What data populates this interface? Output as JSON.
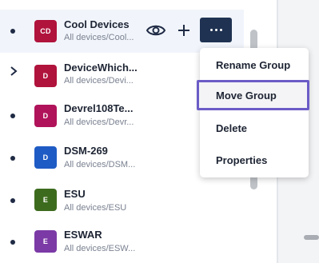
{
  "rows": [
    {
      "avatar_text": "CD",
      "avatar_color": "#b0133c",
      "name": "Cool Devices",
      "path": "All devices/Cool...",
      "lead": "bullet",
      "selected": true
    },
    {
      "avatar_text": "D",
      "avatar_color": "#b0133c",
      "name": "DeviceWhich...",
      "path": "All devices/Devi...",
      "lead": "chevron-right",
      "selected": false
    },
    {
      "avatar_text": "D",
      "avatar_color": "#b0135a",
      "name": "Devrel108Te...",
      "path": "All devices/Devr...",
      "lead": "bullet",
      "selected": false
    },
    {
      "avatar_text": "D",
      "avatar_color": "#1f5bc4",
      "name": "DSM-269",
      "path": "All devices/DSM...",
      "lead": "bullet",
      "selected": false
    },
    {
      "avatar_text": "E",
      "avatar_color": "#3d6b1e",
      "name": "ESU",
      "path": "All devices/ESU",
      "lead": "bullet",
      "selected": false
    },
    {
      "avatar_text": "E",
      "avatar_color": "#7b3aa6",
      "name": "ESWAR",
      "path": "All devices/ESW...",
      "lead": "bullet",
      "selected": false
    }
  ],
  "row_actions": {
    "view_icon": "eye-icon",
    "add_icon": "plus-icon",
    "more_icon": "ellipsis-icon"
  },
  "context_menu": {
    "items": [
      "Rename Group",
      "Move Group",
      "Delete",
      "Properties"
    ],
    "focused_item": "Move Group",
    "focus_color": "#6b5cc7"
  },
  "colors": {
    "more_button_bg": "#1f3252",
    "selected_row_bg": "#f1f5fb"
  }
}
